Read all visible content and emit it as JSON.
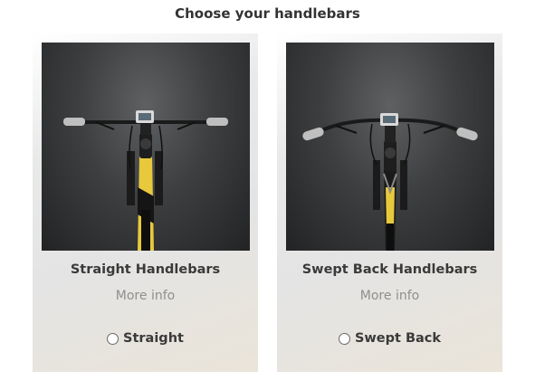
{
  "page": {
    "title": "Choose your handlebars"
  },
  "options": [
    {
      "title": "Straight Handlebars",
      "more_info": "More info",
      "radio_label": "Straight",
      "selected": false,
      "image_icon": "bike-straight-handlebars-photo"
    },
    {
      "title": "Swept Back Handlebars",
      "more_info": "More info",
      "radio_label": "Swept Back",
      "selected": false,
      "image_icon": "bike-swept-back-handlebars-photo"
    }
  ],
  "colors": {
    "frame_yellow": "#e8c93c",
    "photo_dark": "#2a2b2d",
    "muted_text": "#8f8f8f"
  }
}
